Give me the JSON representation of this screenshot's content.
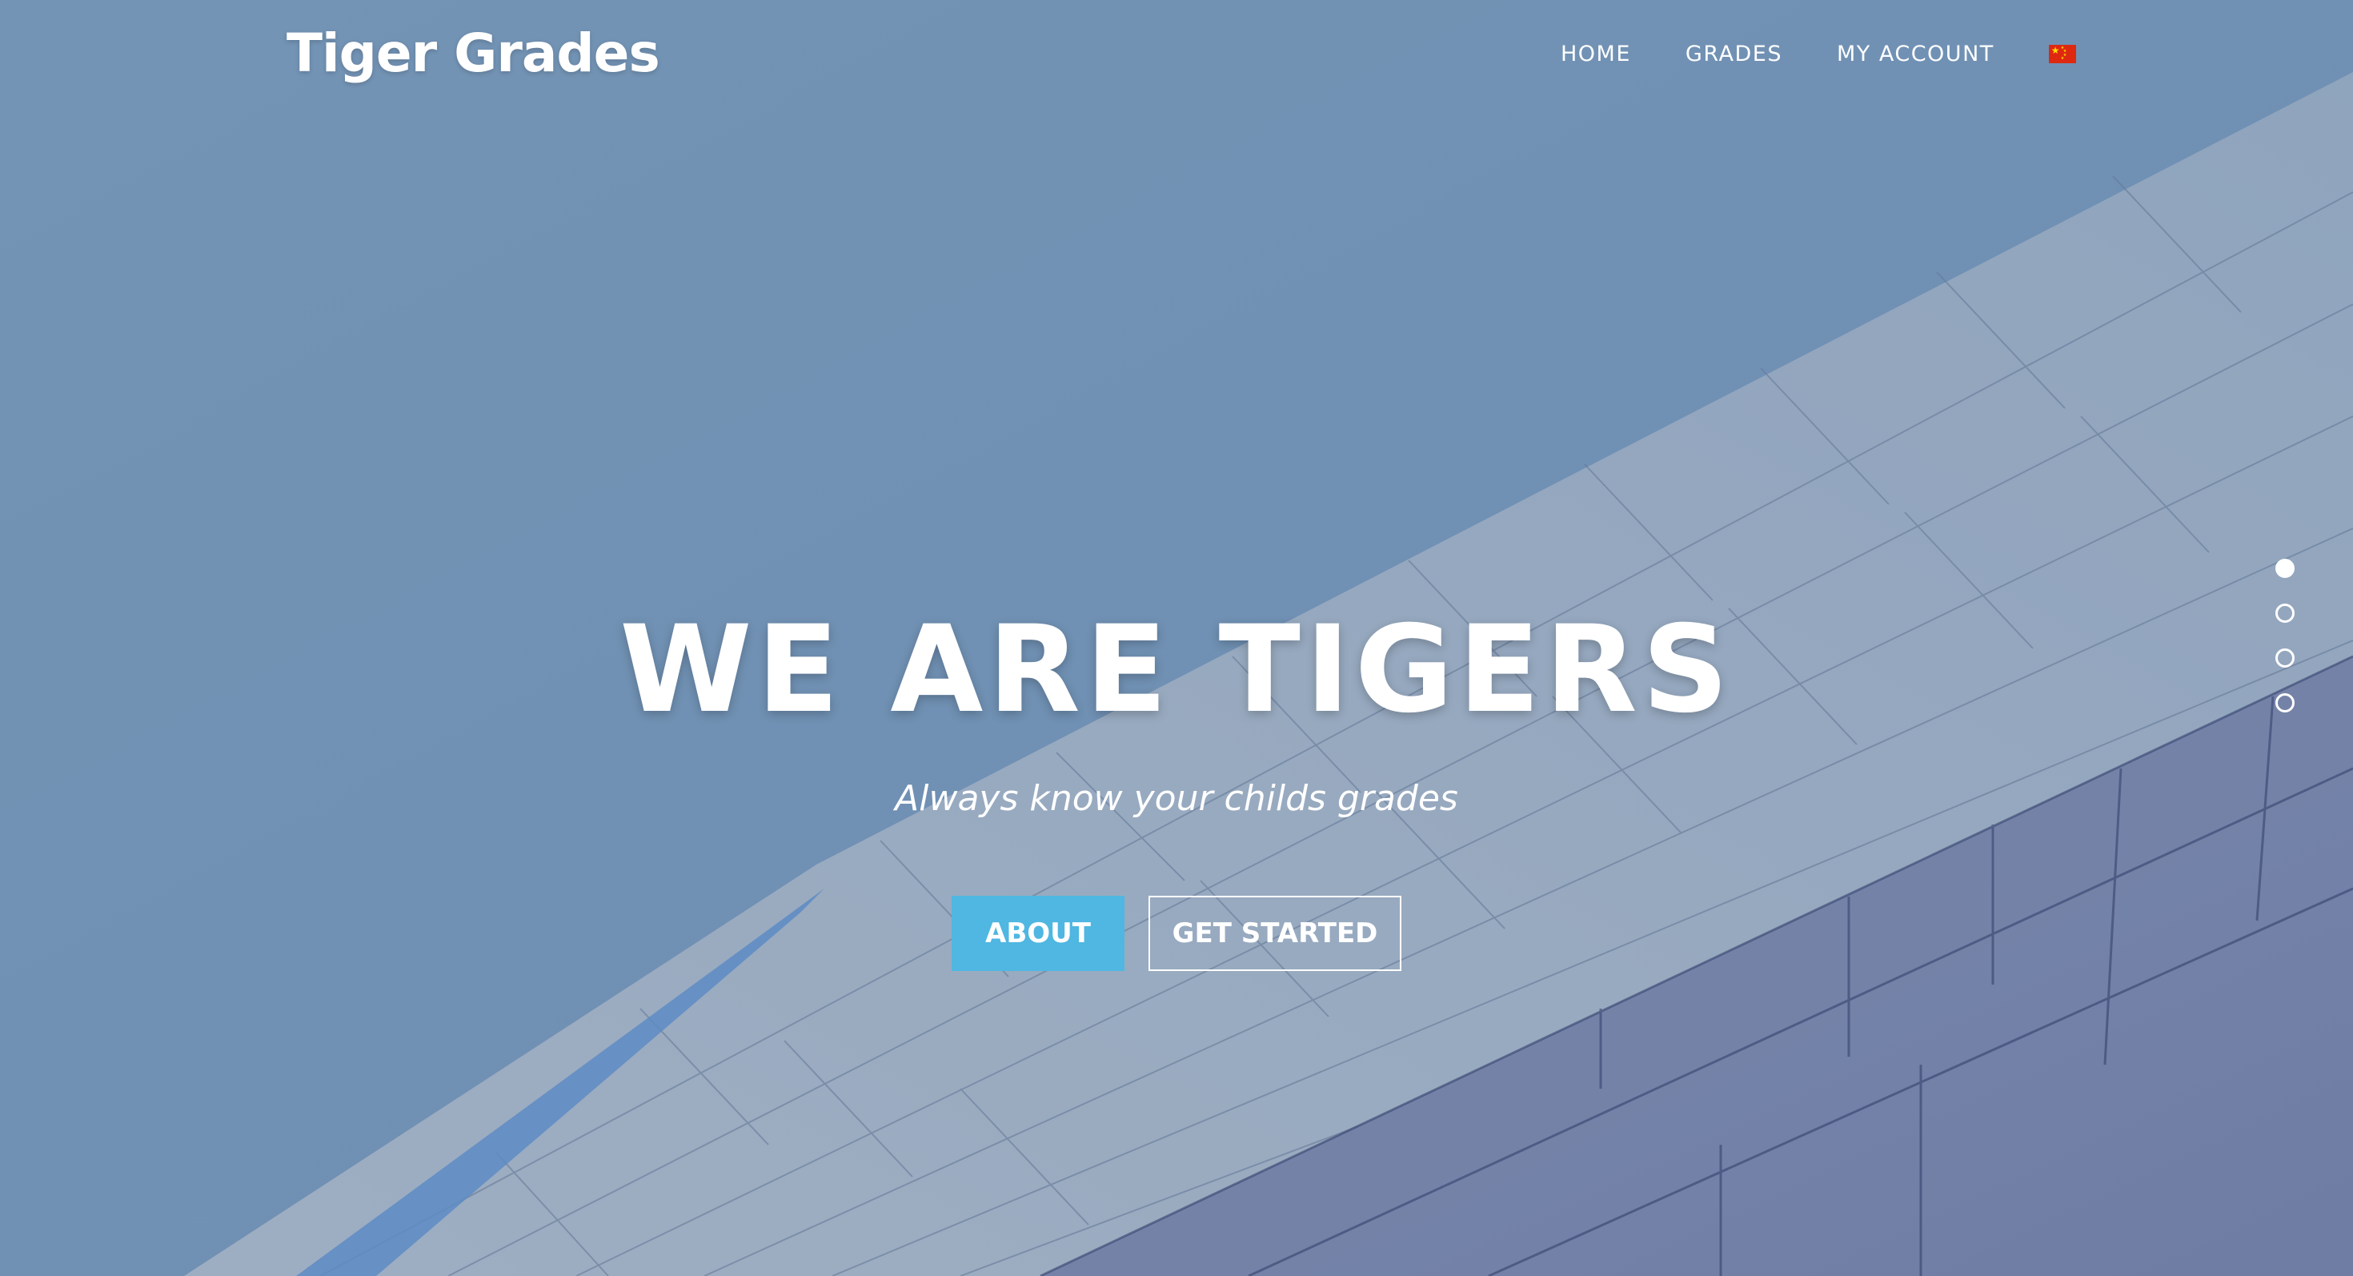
{
  "brand": {
    "name": "Tiger Grades"
  },
  "nav": {
    "items": [
      {
        "label": "HOME"
      },
      {
        "label": "GRADES"
      },
      {
        "label": "MY ACCOUNT"
      }
    ],
    "language_icon": "china-flag-icon"
  },
  "hero": {
    "headline": "WE ARE TIGERS",
    "tagline": "Always know your childs grades",
    "primary_button": "ABOUT",
    "secondary_button": "GET STARTED"
  },
  "slider": {
    "total_slides": 4,
    "active_slide": 1
  },
  "colors": {
    "sky": "#7393b3",
    "primary_button": "#4fb7e1",
    "text": "#ffffff"
  }
}
